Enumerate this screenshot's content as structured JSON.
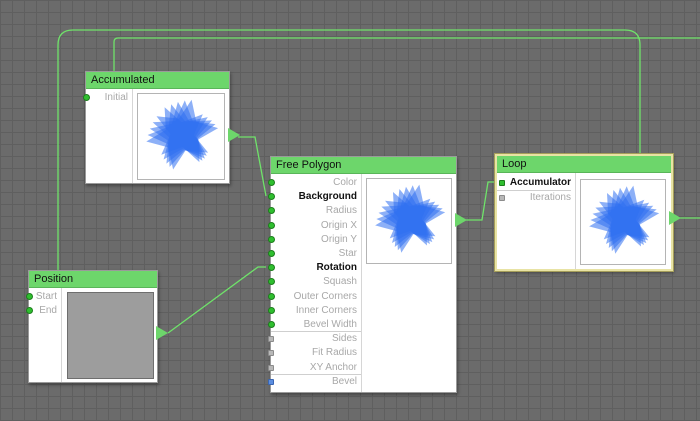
{
  "nodes": {
    "accumulated": {
      "title": "Accumulated",
      "ports": [
        "Initial"
      ]
    },
    "free_polygon": {
      "title": "Free Polygon",
      "ports": [
        "Color",
        "Background",
        "Radius",
        "Origin X",
        "Origin Y",
        "Star",
        "Rotation",
        "Squash",
        "Outer Corners",
        "Inner Corners",
        "Bevel Width",
        "Sides",
        "Fit Radius",
        "XY Anchor",
        "Bevel"
      ],
      "active": [
        "Background",
        "Rotation"
      ]
    },
    "loop": {
      "title": "Loop",
      "ports": [
        "Accumulator",
        "Iterations"
      ]
    },
    "position": {
      "title": "Position",
      "ports": [
        "Start",
        "End"
      ]
    }
  },
  "colors": {
    "wire": "#6fe36a",
    "header": "#6dd66b",
    "star": "#2f6ff0"
  }
}
